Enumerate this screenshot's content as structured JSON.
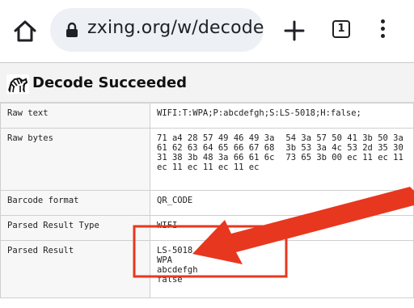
{
  "browser": {
    "url": "zxing.org/w/decode",
    "tab_count": "1"
  },
  "page": {
    "title": "Decode Succeeded",
    "rows": {
      "raw_text": {
        "label": "Raw text",
        "value": "WIFI:T:WPA;P:abcdefgh;S:LS-5018;H:false;"
      },
      "raw_bytes": {
        "label": "Raw bytes",
        "col1": "71 a4 28 57 49 46 49 3a\n61 62 63 64 65 66 67 68\n31 38 3b 48 3a 66 61 6c\nec 11 ec 11 ec 11 ec",
        "col2": "54 3a 57 50 41 3b 50 3a\n3b 53 3a 4c 53 2d 35 30\n73 65 3b 00 ec 11 ec 11\n"
      },
      "barcode_format": {
        "label": "Barcode format",
        "value": "QR_CODE"
      },
      "parsed_type": {
        "label": "Parsed Result Type",
        "value": "WIFI"
      },
      "parsed_result": {
        "label": "Parsed Result",
        "lines": [
          "LS-5018",
          "WPA",
          "abcdefgh",
          "false"
        ]
      }
    }
  },
  "annotation": {
    "color": "#e8371f"
  }
}
